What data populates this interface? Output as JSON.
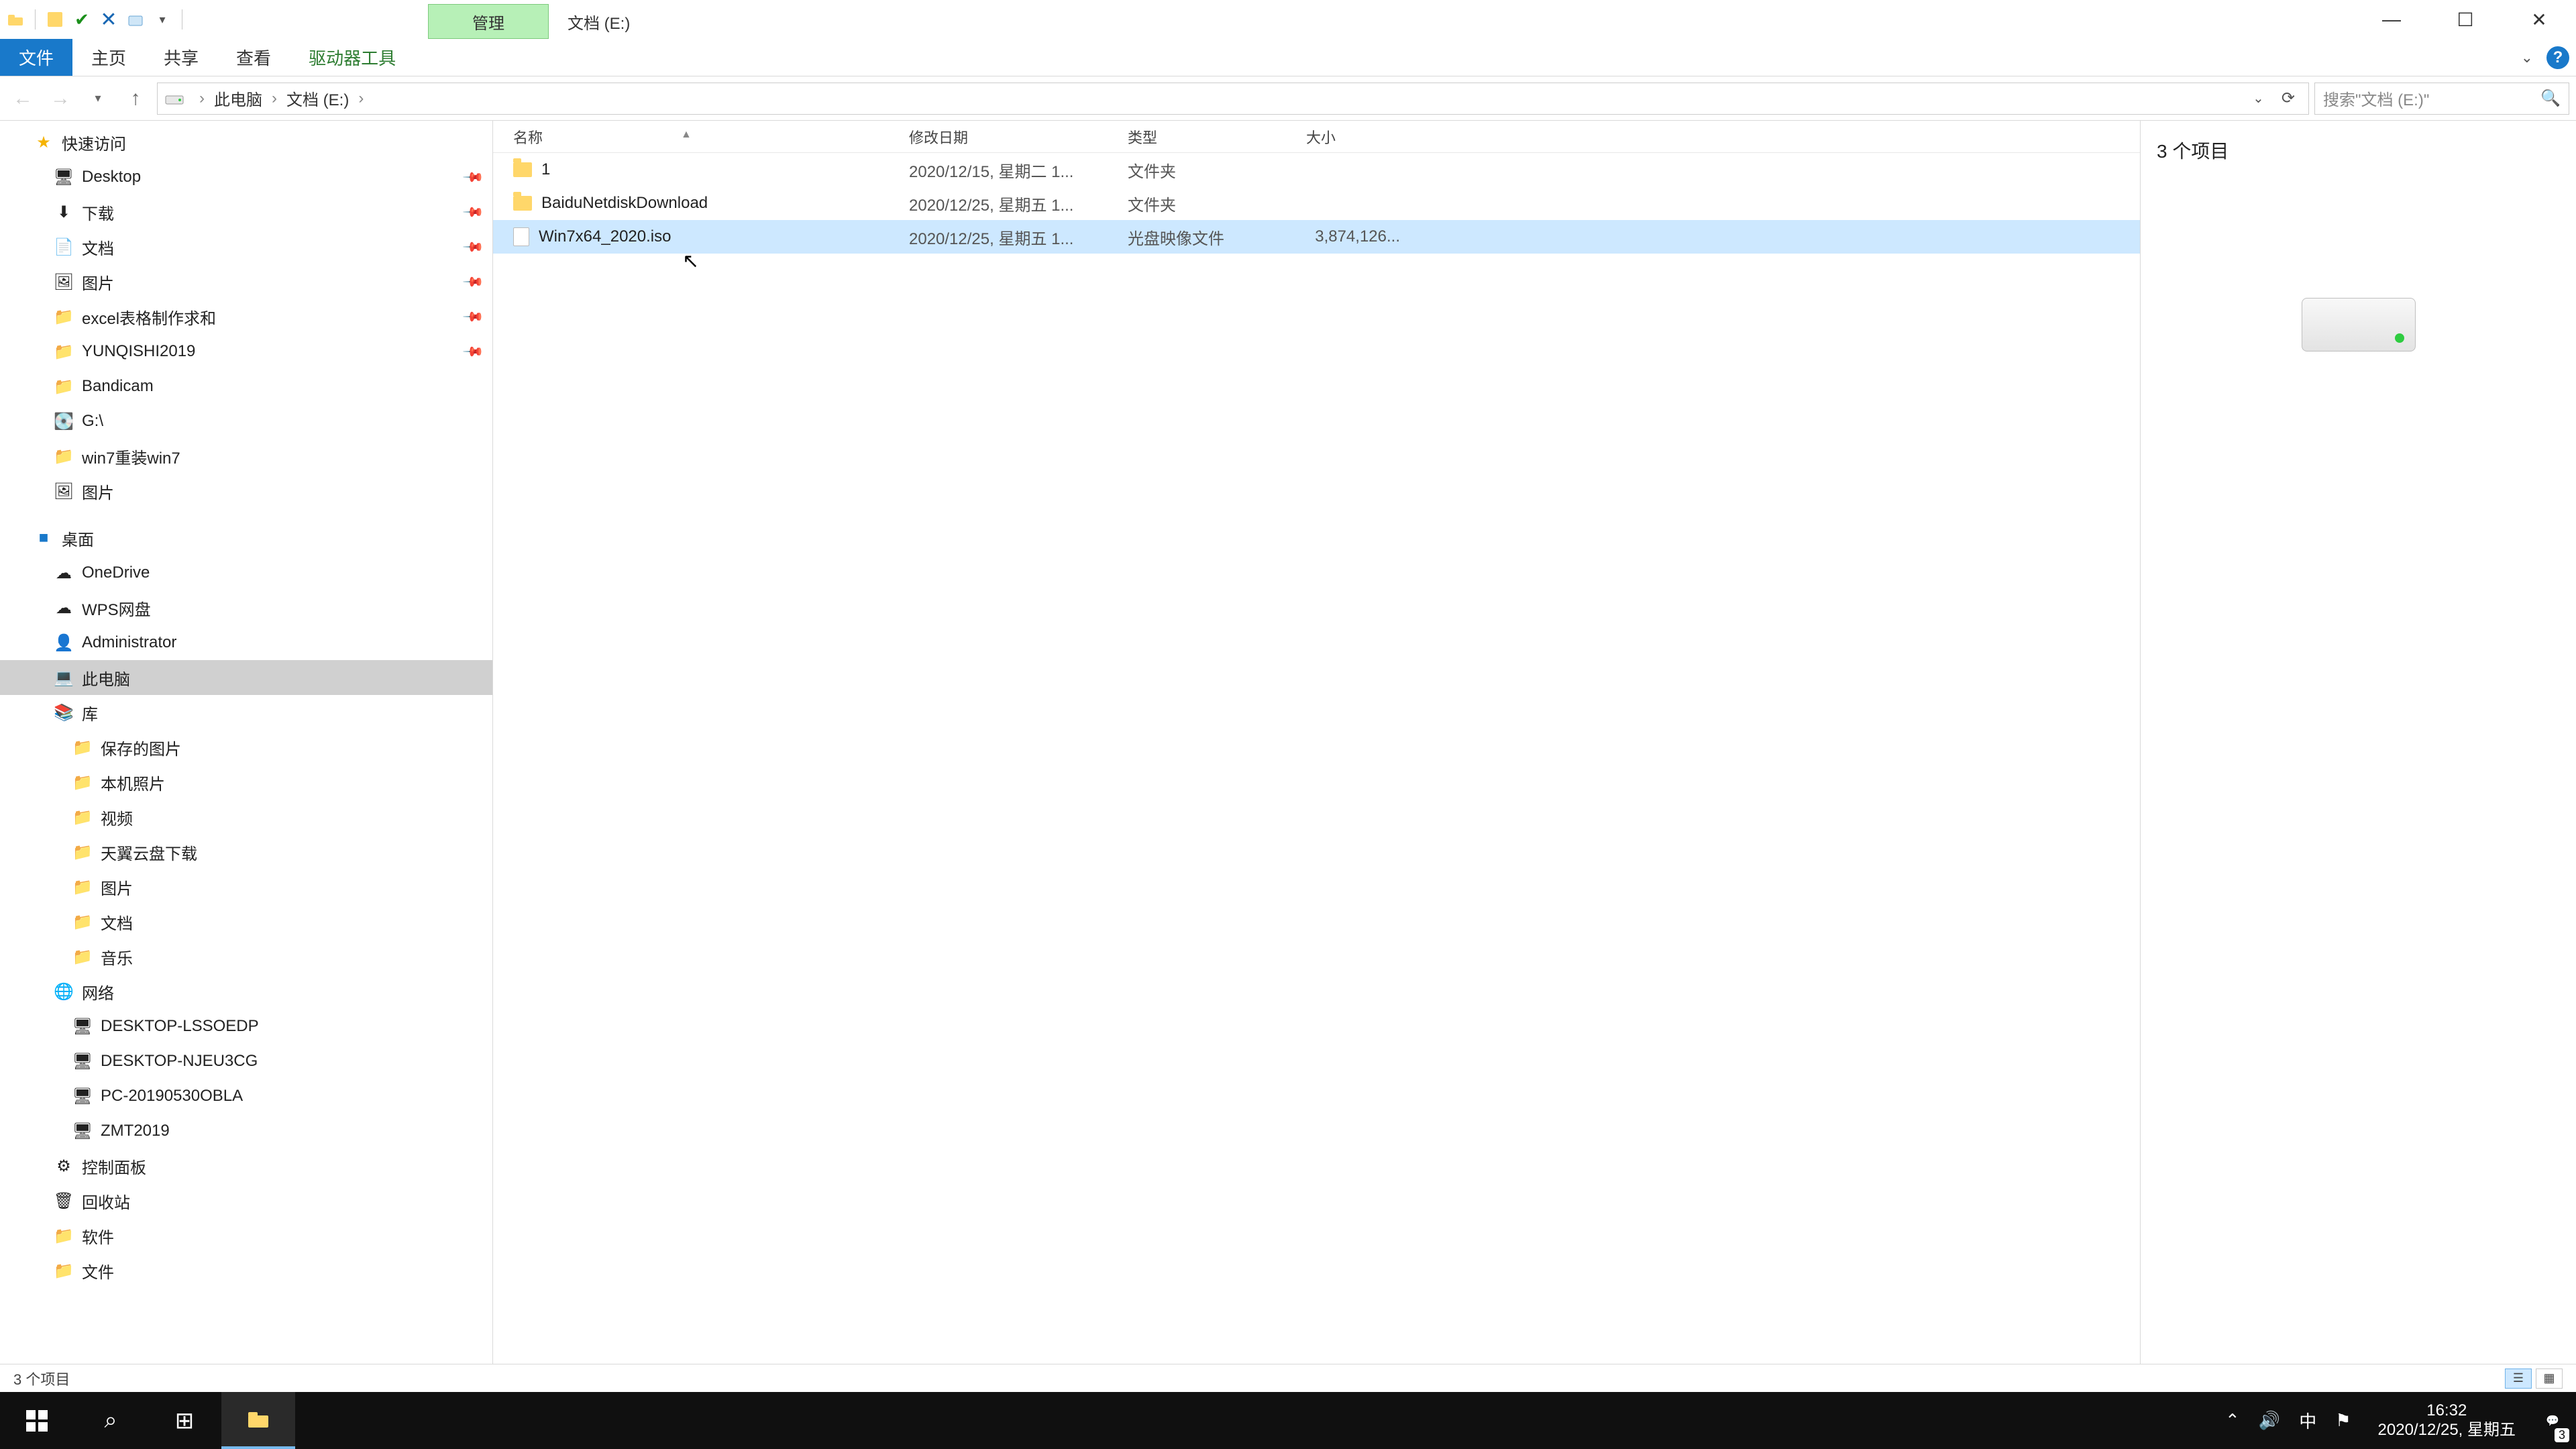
{
  "title": {
    "context_tab": "管理",
    "location": "文档 (E:)"
  },
  "ribbon": {
    "file": "文件",
    "home": "主页",
    "share": "共享",
    "view": "查看",
    "drive": "驱动器工具"
  },
  "breadcrumb": {
    "root": "此电脑",
    "loc": "文档 (E:)"
  },
  "search": {
    "placeholder": "搜索\"文档 (E:)\""
  },
  "cols": {
    "name": "名称",
    "date": "修改日期",
    "type": "类型",
    "size": "大小"
  },
  "rows": [
    {
      "name": "1",
      "date": "2020/12/15, 星期二 1...",
      "type": "文件夹",
      "size": "",
      "icon": "folder",
      "sel": false
    },
    {
      "name": "BaiduNetdiskDownload",
      "date": "2020/12/25, 星期五 1...",
      "type": "文件夹",
      "size": "",
      "icon": "folder",
      "sel": false
    },
    {
      "name": "Win7x64_2020.iso",
      "date": "2020/12/25, 星期五 1...",
      "type": "光盘映像文件",
      "size": "3,874,126...",
      "icon": "file",
      "sel": true
    }
  ],
  "nav": {
    "quick": "快速访问",
    "quick_items": [
      "Desktop",
      "下载",
      "文档",
      "图片",
      "excel表格制作求和",
      "YUNQISHI2019",
      "Bandicam",
      "G:\\",
      "win7重装win7",
      "图片"
    ],
    "desktop": "桌面",
    "desktop_items": [
      "OneDrive",
      "WPS网盘",
      "Administrator",
      "此电脑",
      "库",
      "控制面板",
      "回收站",
      "软件",
      "文件"
    ],
    "lib_items": [
      "保存的图片",
      "本机照片",
      "视频",
      "天翼云盘下载",
      "图片",
      "文档",
      "音乐"
    ],
    "network": "网络",
    "net_items": [
      "DESKTOP-LSSOEDP",
      "DESKTOP-NJEU3CG",
      "PC-20190530OBLA",
      "ZMT2019"
    ]
  },
  "preview": {
    "count": "3 个项目"
  },
  "status": {
    "text": "3 个项目"
  },
  "taskbar": {
    "time": "16:32",
    "date": "2020/12/25, 星期五",
    "ime": "中",
    "notif_count": "3"
  }
}
